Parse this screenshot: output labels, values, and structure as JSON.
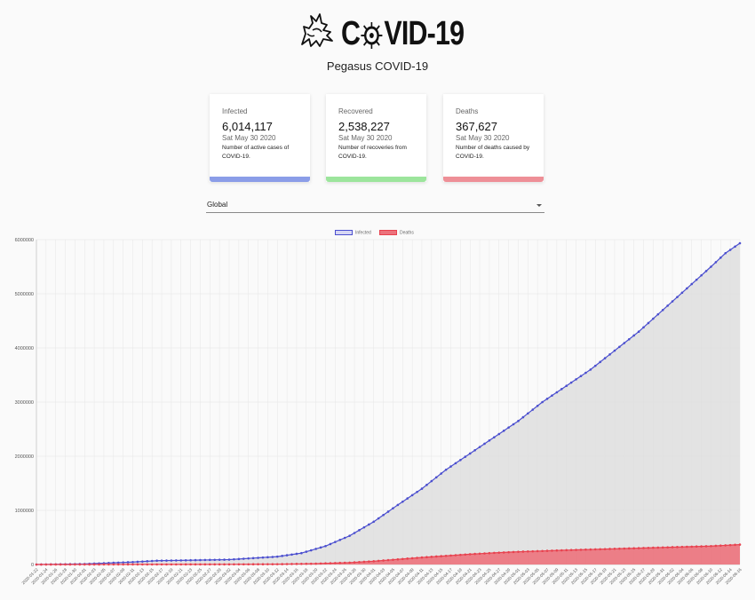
{
  "header": {
    "logo_text_pre": "C",
    "logo_text_post": "VID-19",
    "subtitle": "Pegasus COVID-19"
  },
  "cards": [
    {
      "label": "Infected",
      "value": "6,014,117",
      "date": "Sat May 30 2020",
      "desc": "Number of active cases of COVID-19.",
      "color": "#8b9de8"
    },
    {
      "label": "Recovered",
      "value": "2,538,227",
      "date": "Sat May 30 2020",
      "desc": "Number of recoveries from COVID-19.",
      "color": "#9ce59c"
    },
    {
      "label": "Deaths",
      "value": "367,627",
      "date": "Sat May 30 2020",
      "desc": "Number of deaths caused by COVID-19.",
      "color": "#ee8f97"
    }
  ],
  "region_select": {
    "value": "Global"
  },
  "chart_data": {
    "type": "line",
    "ylim": [
      0,
      6000000
    ],
    "yticks": [
      "0",
      "1000000",
      "2000000",
      "3000000",
      "4000000",
      "5000000",
      "6000000"
    ],
    "x_label_format": "YYYY-MM-DD, every other day",
    "x_start": "2020-01-22",
    "x_end": "2020-05-29",
    "series": [
      {
        "name": "Infected",
        "color": "#4b4fcf",
        "fill": "#dedede",
        "keypoints": [
          [
            0,
            0
          ],
          [
            10,
            10000
          ],
          [
            20,
            45000
          ],
          [
            25,
            70000
          ],
          [
            30,
            76000
          ],
          [
            40,
            90000
          ],
          [
            50,
            145000
          ],
          [
            55,
            210000
          ],
          [
            60,
            340000
          ],
          [
            65,
            530000
          ],
          [
            70,
            790000
          ],
          [
            75,
            1100000
          ],
          [
            80,
            1400000
          ],
          [
            85,
            1750000
          ],
          [
            90,
            2050000
          ],
          [
            95,
            2350000
          ],
          [
            100,
            2650000
          ],
          [
            105,
            3000000
          ],
          [
            110,
            3300000
          ],
          [
            115,
            3600000
          ],
          [
            120,
            3950000
          ],
          [
            125,
            4300000
          ],
          [
            130,
            4700000
          ],
          [
            135,
            5100000
          ],
          [
            140,
            5500000
          ],
          [
            143,
            5750000
          ],
          [
            146,
            5934000
          ]
        ]
      },
      {
        "name": "Deaths",
        "color": "#e8424f",
        "fill": "#ec727c",
        "keypoints": [
          [
            0,
            0
          ],
          [
            40,
            3000
          ],
          [
            50,
            6000
          ],
          [
            58,
            15000
          ],
          [
            65,
            35000
          ],
          [
            70,
            60000
          ],
          [
            75,
            95000
          ],
          [
            80,
            130000
          ],
          [
            85,
            160000
          ],
          [
            90,
            190000
          ],
          [
            95,
            215000
          ],
          [
            100,
            235000
          ],
          [
            110,
            265000
          ],
          [
            120,
            290000
          ],
          [
            130,
            315000
          ],
          [
            140,
            340000
          ],
          [
            146,
            367627
          ]
        ]
      }
    ]
  }
}
